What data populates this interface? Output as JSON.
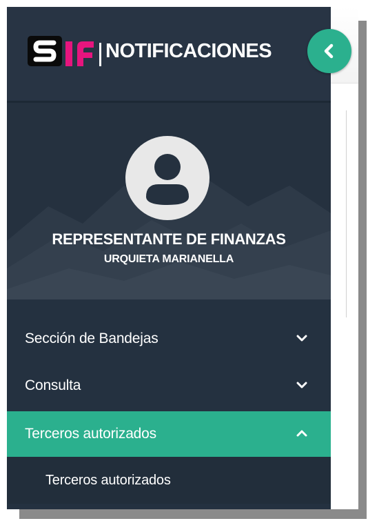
{
  "header": {
    "logo_name": "sif-logo",
    "title": "NOTIFICACIONES",
    "collapse_icon": "chevron-left-icon",
    "accent_color": "#2bb08e"
  },
  "profile": {
    "avatar_icon": "user-avatar-icon",
    "role": "REPRESENTANTE DE FINANZAS",
    "name": "URQUIETA MARIANELLA"
  },
  "menu": {
    "items": [
      {
        "label": "Sección de Bandejas",
        "icon": "chevron-down-icon",
        "expanded": false
      },
      {
        "label": "Consulta",
        "icon": "chevron-down-icon",
        "expanded": false
      },
      {
        "label": "Terceros autorizados",
        "icon": "chevron-up-icon",
        "expanded": true,
        "children": [
          {
            "label": "Terceros autorizados"
          }
        ]
      }
    ]
  },
  "colors": {
    "sidebar_bg": "#243140",
    "active_bg": "#2bb08e",
    "text": "#ffffff"
  }
}
